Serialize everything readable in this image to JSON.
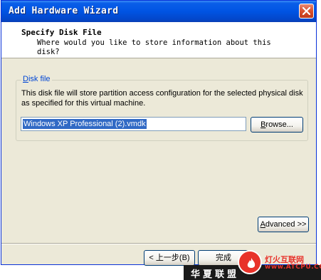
{
  "window": {
    "title": "Add Hardware Wizard",
    "close_icon": "close-icon"
  },
  "header": {
    "title": "Specify Disk File",
    "subtitle": "Where would you like to store information about this disk?"
  },
  "disk_file": {
    "group_label": "Disk file",
    "description": "This disk file will store partition access configuration for the selected physical disk as specified for this virtual machine.",
    "value": "Windows XP Professional (2).vmdk",
    "browse_label": "Browse..."
  },
  "buttons": {
    "advanced_label": "Advanced >>",
    "back_label": "< 上一步(B)",
    "finish_label": "完成"
  },
  "watermarks": {
    "bar_text": "华夏联盟",
    "logo_text": "灯火互联网",
    "logo_url": "www.ATCPU.COM"
  },
  "colors": {
    "titlebar": "#0054e3",
    "dialog_bg": "#ece9d8",
    "group_label": "#0046d5",
    "selection": "#316ac5",
    "close_button": "#d9502e"
  }
}
